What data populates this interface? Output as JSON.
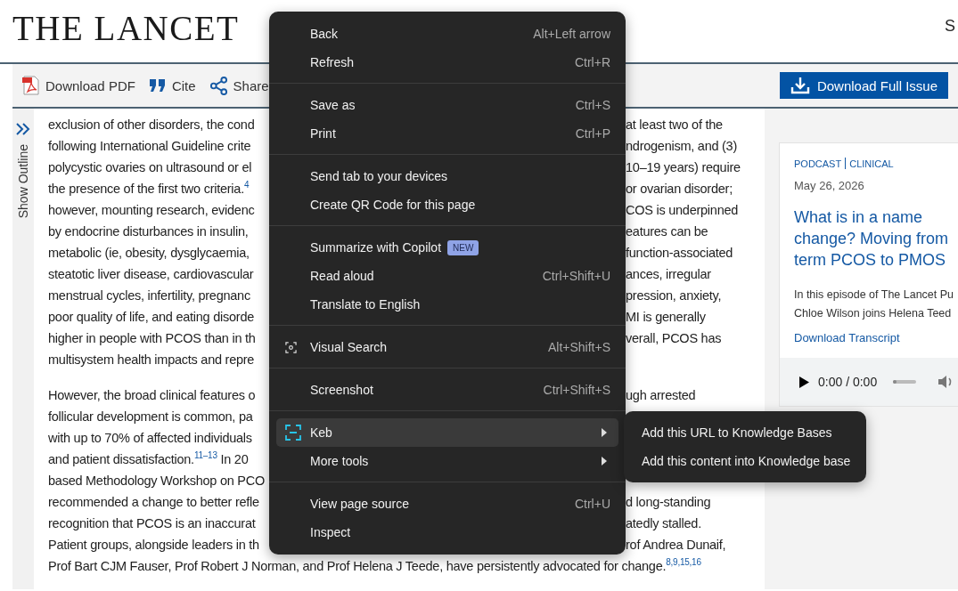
{
  "header": {
    "logo": "THE LANCET",
    "right_text": "S"
  },
  "toolbar": {
    "items": [
      {
        "kind": "pdf",
        "label": "Download PDF"
      },
      {
        "kind": "cite",
        "label": "Cite"
      },
      {
        "kind": "share",
        "label": "Share"
      }
    ],
    "issue_button": "Download Full Issue"
  },
  "outline": {
    "label": "Show Outline"
  },
  "article": {
    "paragraphs": [
      {
        "lines": [
          {
            "left": "exclusion of other disorders, the cond",
            "right": "at least two of the"
          },
          {
            "left": "following International Guideline crite",
            "right": "ndrogenism, and (3)"
          },
          {
            "left": "polycystic ovaries on ultrasound or el",
            "right": "10–19 years) require"
          },
          {
            "left": "the presence of the first two criteria.$^{4}$",
            "right": "or ovarian disorder;"
          },
          {
            "left": "however, mounting research, evidenc",
            "right": "COS is underpinned"
          },
          {
            "left": "by endocrine disturbances in insulin,",
            "right": "eatures can be"
          },
          {
            "left": "metabolic (ie, obesity, dysglycaemia,",
            "right": "function-associated"
          },
          {
            "left": "steatotic liver disease, cardiovascular",
            "right": "ances, irregular"
          },
          {
            "left": "menstrual cycles, infertility, pregnanc",
            "right": "pression, anxiety,"
          },
          {
            "left": "poor quality of life, and eating disorde",
            "right": "MI is generally"
          },
          {
            "left": "higher in people with PCOS than in th",
            "right": "verall, PCOS has"
          },
          {
            "left": "multisystem health impacts and repre"
          }
        ]
      },
      {
        "lines": [
          {
            "left": "However, the broad clinical features o",
            "right": "ugh arrested"
          },
          {
            "left": "follicular development is common, pa"
          },
          {
            "left": "with up to 70% of affected individuals"
          },
          {
            "left": "and patient dissatisfaction.$^{11–13}$ In 20"
          },
          {
            "left": "based Methodology Workshop on PCO"
          },
          {
            "left": "recommended a change to better refle",
            "right": "d long-standing"
          },
          {
            "left": "recognition that PCOS is an inaccurat",
            "right": "atedly stalled."
          },
          {
            "left": "Patient groups, alongside leaders in th",
            "right": "rof Andrea Dunaif,"
          },
          {
            "full": "Prof Bart CJM Fauser, Prof Robert J Norman, and Prof Helena J Teede, have persistently advocated for change.$^{8,9,15,16}$"
          }
        ]
      }
    ]
  },
  "podcast": {
    "category": "PODCAST",
    "tag": "CLINICAL",
    "date": "May 26, 2026",
    "title_lines": [
      "What is in a name",
      "change? Moving from",
      "term PCOS to PMOS"
    ],
    "description_lines": [
      "In this episode of The Lancet Pu",
      "Chloe Wilson joins Helena Teed"
    ],
    "link": "Download Transcript",
    "time": "0:00 / 0:00",
    "progress": {
      "level": 0
    }
  },
  "menu": {
    "groups": [
      {
        "items": [
          {
            "kind": "plain",
            "label": "Back",
            "shortcut": "Alt+Left arrow",
            "has_submenu": false,
            "selected": false
          },
          {
            "kind": "plain",
            "label": "Refresh",
            "shortcut": "Ctrl+R",
            "has_submenu": false,
            "selected": false
          }
        ]
      },
      {
        "items": [
          {
            "kind": "plain",
            "label": "Save as",
            "shortcut": "Ctrl+S",
            "has_submenu": false,
            "selected": false
          },
          {
            "kind": "plain",
            "label": "Print",
            "shortcut": "Ctrl+P",
            "has_submenu": false,
            "selected": false
          }
        ]
      },
      {
        "items": [
          {
            "kind": "plain",
            "label": "Send tab to your devices",
            "has_submenu": false,
            "selected": false
          },
          {
            "kind": "plain",
            "label": "Create QR Code for this page",
            "has_submenu": false,
            "selected": false
          }
        ]
      },
      {
        "items": [
          {
            "kind": "plain",
            "label": "Summarize with Copilot",
            "badge": "NEW",
            "has_submenu": false,
            "selected": false
          },
          {
            "kind": "plain",
            "label": "Read aloud",
            "shortcut": "Ctrl+Shift+U",
            "has_submenu": false,
            "selected": false
          },
          {
            "kind": "plain",
            "label": "Translate to English",
            "has_submenu": false,
            "selected": false
          }
        ]
      },
      {
        "items": [
          {
            "kind": "lens",
            "label": "Visual Search",
            "shortcut": "Alt+Shift+S",
            "has_submenu": false,
            "selected": false
          }
        ]
      },
      {
        "items": [
          {
            "kind": "plain",
            "label": "Screenshot",
            "shortcut": "Ctrl+Shift+S",
            "has_submenu": false,
            "selected": false
          }
        ]
      },
      {
        "items": [
          {
            "kind": "extension",
            "label": "Keb",
            "has_submenu": true,
            "selected": true
          },
          {
            "kind": "plain",
            "label": "More tools",
            "has_submenu": true,
            "selected": false
          }
        ]
      },
      {
        "items": [
          {
            "kind": "plain",
            "label": "View page source",
            "shortcut": "Ctrl+U",
            "has_submenu": false,
            "selected": false
          },
          {
            "kind": "plain",
            "label": "Inspect",
            "has_submenu": false,
            "selected": false
          }
        ]
      }
    ]
  },
  "submenu": {
    "items": [
      "Add this URL to Knowledge Bases",
      "Add this content into Knowledge base"
    ]
  }
}
